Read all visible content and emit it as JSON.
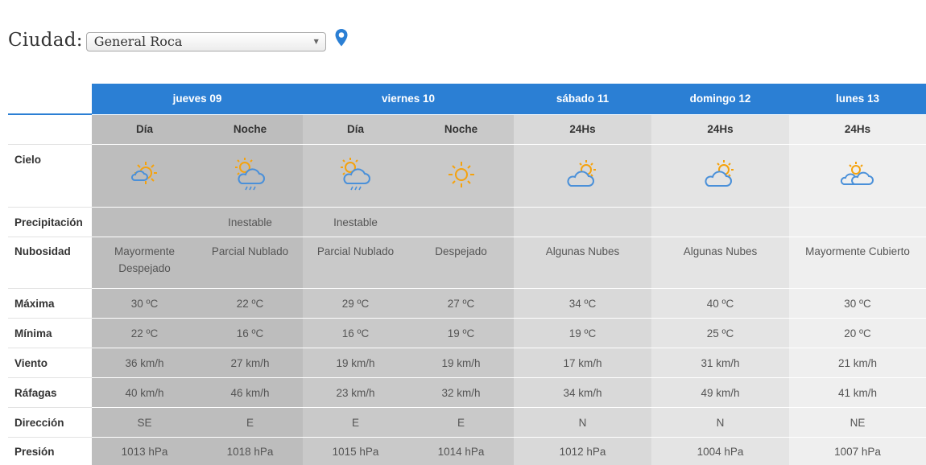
{
  "city": {
    "label": "Ciudad:",
    "selected": "General Roca",
    "location_icon": "map-pin-icon",
    "location_icon_color": "#2b7fd4"
  },
  "colors": {
    "header_blue": "#2b7fd4",
    "sun_orange": "#f5a20d",
    "cloud_blue": "#4a90d9"
  },
  "days": [
    "jueves 09",
    "viernes 10",
    "sábado 11",
    "domingo 12",
    "lunes 13"
  ],
  "periods": [
    "Día",
    "Noche",
    "Día",
    "Noche",
    "24Hs",
    "24Hs",
    "24Hs"
  ],
  "row_labels": {
    "sky": "Cielo",
    "precip": "Precipitación",
    "cloud": "Nubosidad",
    "max": "Máxima",
    "min": "Mínima",
    "wind": "Viento",
    "gust": "Ráfagas",
    "dir": "Dirección",
    "pressure": "Presión"
  },
  "sky_icons": [
    "sun-behind-small-cloud-icon",
    "sun-cloud-rain-icon",
    "sun-cloud-rain-icon",
    "sun-icon",
    "sun-behind-cloud-icon",
    "sun-behind-cloud-icon",
    "sun-behind-clouds-icon"
  ],
  "precip": [
    "",
    "Inestable",
    "Inestable",
    "",
    "",
    "",
    ""
  ],
  "cloud": [
    "Mayormente Despejado",
    "Parcial Nublado",
    "Parcial Nublado",
    "Despejado",
    "Algunas Nubes",
    "Algunas Nubes",
    "Mayormente Cubierto"
  ],
  "max": [
    "30 ºC",
    "22 ºC",
    "29 ºC",
    "27 ºC",
    "34 ºC",
    "40 ºC",
    "30 ºC"
  ],
  "min": [
    "22 ºC",
    "16 ºC",
    "16 ºC",
    "19 ºC",
    "19 ºC",
    "25 ºC",
    "20 ºC"
  ],
  "wind": [
    "36 km/h",
    "27 km/h",
    "19 km/h",
    "19 km/h",
    "17 km/h",
    "31 km/h",
    "21 km/h"
  ],
  "gust": [
    "40 km/h",
    "46 km/h",
    "23 km/h",
    "32 km/h",
    "34 km/h",
    "49 km/h",
    "41 km/h"
  ],
  "dir": [
    "SE",
    "E",
    "E",
    "E",
    "N",
    "N",
    "NE"
  ],
  "pressure": [
    "1013 hPa",
    "1018 hPa",
    "1015 hPa",
    "1014 hPa",
    "1012 hPa",
    "1004 hPa",
    "1007 hPa"
  ]
}
